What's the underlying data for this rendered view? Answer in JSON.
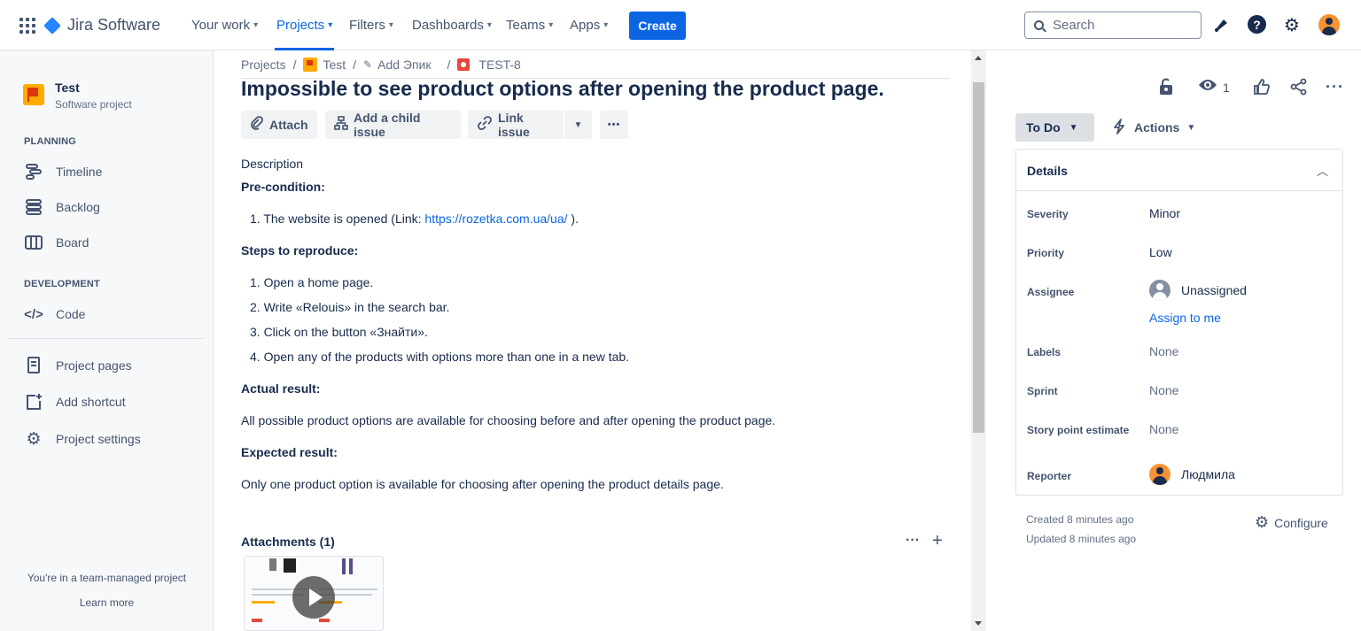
{
  "topnav": {
    "logo": "Jira Software",
    "items": [
      {
        "label": "Your work"
      },
      {
        "label": "Projects"
      },
      {
        "label": "Filters"
      },
      {
        "label": "Dashboards"
      },
      {
        "label": "Teams"
      },
      {
        "label": "Apps"
      }
    ],
    "active_item": "Projects",
    "create": "Create",
    "search_placeholder": "Search",
    "icons": [
      "apps-grid-icon",
      "notifications-icon",
      "help-icon",
      "settings-icon",
      "avatar"
    ]
  },
  "sidebar": {
    "project_name": "Test",
    "project_type": "Software project",
    "planning_label": "PLANNING",
    "planning_items": [
      "Timeline",
      "Backlog",
      "Board"
    ],
    "development_label": "DEVELOPMENT",
    "development_items": [
      "Code"
    ],
    "bottom_items": [
      "Project pages",
      "Add shortcut",
      "Project settings"
    ],
    "team_note": "You're in a team-managed project",
    "learn_more": "Learn more"
  },
  "breadcrumb": {
    "projects": "Projects",
    "project": "Test",
    "epic": "Add Эпик",
    "issue_key": "TEST-8",
    "sep": "/"
  },
  "issue": {
    "title": "Impossible to see product options after opening the product page.",
    "actions": {
      "attach": "Attach",
      "child": "Add a child issue",
      "link": "Link issue",
      "more": "•••"
    },
    "description_label": "Description",
    "precondition_heading": "Pre-condition:",
    "precondition_text": "1. The website is opened (Link: ",
    "precondition_link": "https://rozetka.com.ua/ua/",
    "precondition_end": " ).",
    "steps_heading": "Steps to reproduce:",
    "steps": [
      "1.  Open a home page.",
      "2. Write «Relouis» in the search bar.",
      "3. Click on the button «Знайти».",
      "4. Open any of the products with options more than one in a new tab."
    ],
    "actual_heading": "Actual result:",
    "actual_text": "All possible product options are available for choosing before and after opening the product page.",
    "expected_heading": "Expected result:",
    "expected_text": " Only one product option is available for choosing after opening the product details page.",
    "attachments_label": "Attachments (1)"
  },
  "right_panel": {
    "watch_count": "1",
    "status": "To Do",
    "actions": "Actions",
    "details_title": "Details",
    "fields": [
      {
        "label": "Severity",
        "value": "Minor"
      },
      {
        "label": "Priority",
        "value": "Low"
      },
      {
        "label": "Assignee",
        "value": "Unassigned"
      },
      {
        "label": "Labels",
        "value": "None"
      },
      {
        "label": "Sprint",
        "value": "None"
      },
      {
        "label": "Story point estimate",
        "value": "None"
      },
      {
        "label": "Reporter",
        "value": "Людмила"
      }
    ],
    "assign_to_me": "Assign to me",
    "created": "Created 8 minutes ago",
    "updated": "Updated 8 minutes ago",
    "configure": "Configure"
  },
  "colors": {
    "brand_blue": "#0c66e4",
    "sidebar_bg": "#f7f8f9",
    "text": "#172b4d"
  }
}
